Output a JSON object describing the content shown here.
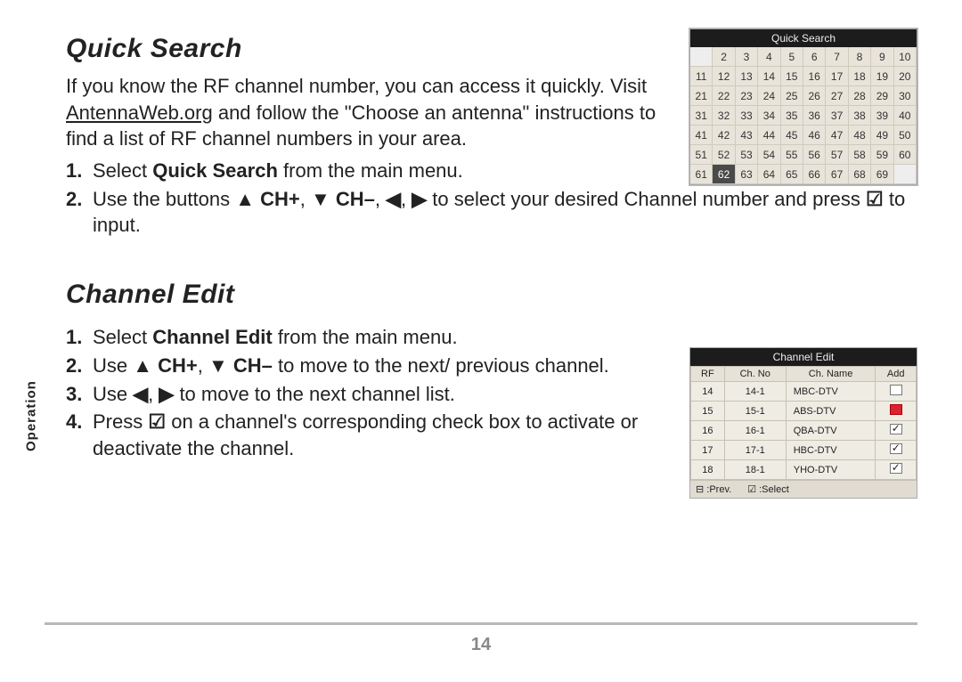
{
  "sideTab": "Operation",
  "pageNumber": "14",
  "section1": {
    "title": "Quick Search",
    "intro_a": "If you know the RF channel number, you can access it quickly. Visit ",
    "intro_link": "AntennaWeb.org",
    "intro_b": " and follow the \"Choose an antenna\" instructions to find a list of RF channel numbers in your area.",
    "step1_a": "Select ",
    "step1_bold": "Quick Search",
    "step1_b": " from the main menu.",
    "step2_a": "Use the buttons ",
    "step2_chplus": "▲ CH+",
    "step2_sep1": ", ",
    "step2_chminus": "▼ CH–",
    "step2_sep2": ", ",
    "step2_left": "◀",
    "step2_sep3": ", ",
    "step2_right": "▶",
    "step2_b": " to select your desired Channel number and press ",
    "step2_check": "☑",
    "step2_c": " to input.",
    "fig": {
      "title": "Quick Search",
      "start": 2,
      "end": 69,
      "columns": 10,
      "highlight": 62
    }
  },
  "section2": {
    "title": "Channel Edit",
    "step1_a": "Select ",
    "step1_bold": "Channel Edit",
    "step1_b": " from the main menu.",
    "step2_a": "Use ",
    "step2_chplus": "▲ CH+",
    "step2_sep1": ", ",
    "step2_chminus": "▼ CH–",
    "step2_b": " to move to the next/ previous channel.",
    "step3_a": "Use ",
    "step3_left": "◀",
    "step3_sep": ", ",
    "step3_right": "▶",
    "step3_b": " to move to the next channel list.",
    "step4_a": "Press ",
    "step4_check": "☑",
    "step4_b": " on a channel's corresponding check box to activate or deactivate the channel.",
    "fig": {
      "title": "Channel Edit",
      "cols": {
        "rf": "RF",
        "chno": "Ch. No",
        "chname": "Ch. Name",
        "add": "Add"
      },
      "rows": [
        {
          "rf": "14",
          "no": "14-1",
          "name": "MBC-DTV",
          "checked": false,
          "sel": false
        },
        {
          "rf": "15",
          "no": "15-1",
          "name": "ABS-DTV",
          "checked": false,
          "sel": true
        },
        {
          "rf": "16",
          "no": "16-1",
          "name": "QBA-DTV",
          "checked": true,
          "sel": false
        },
        {
          "rf": "17",
          "no": "17-1",
          "name": "HBC-DTV",
          "checked": true,
          "sel": false
        },
        {
          "rf": "18",
          "no": "18-1",
          "name": "YHO-DTV",
          "checked": true,
          "sel": false
        }
      ],
      "footer": {
        "prev": ":Prev.",
        "select": ":Select"
      }
    }
  }
}
